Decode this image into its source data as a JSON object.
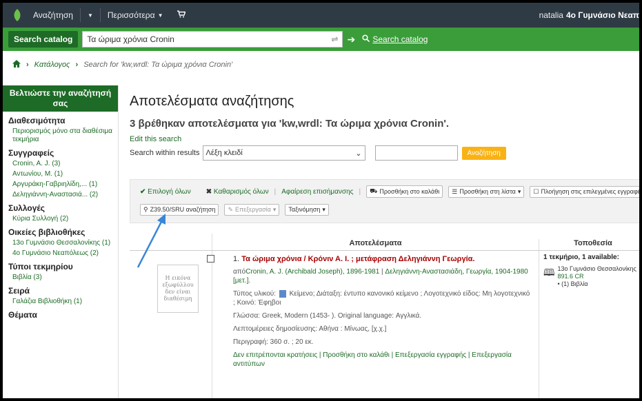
{
  "topnav": {
    "search_label": "Αναζήτηση",
    "more_label": "Περισσότερα",
    "user_name": "natalia",
    "library": "4ο Γυμνάσιο Νεαπ"
  },
  "searchbar": {
    "label": "Search catalog",
    "query": "Τα ώριμα χρόνια Cronin",
    "search_link": "Search catalog"
  },
  "breadcrumb": {
    "catalog": "Κατάλογος",
    "current": "Search for 'kw,wrdl: Τα ώριμα χρόνια Cronin'"
  },
  "sidebar": {
    "refine_title": "Βελτιώστε την αναζήτησή σας",
    "facets": [
      {
        "title": "Διαθεσιμότητα",
        "items": [
          "Περιορισμός μόνο στα διαθέσιμα τεκμήρια"
        ]
      },
      {
        "title": "Συγγραφείς",
        "items": [
          "Cronin, A. J. (3)",
          "Αντωνίου, Μ. (1)",
          "Αργυράκη-Γαβριηλίδη,... (1)",
          "Δεληγιάννη-Αναστασιά... (2)"
        ]
      },
      {
        "title": "Συλλογές",
        "items": [
          "Κύρια Συλλογή (2)"
        ]
      },
      {
        "title": "Οικείες βιβλιοθήκες",
        "items": [
          "13ο Γυμνάσιο Θεσσαλονίκης (1)",
          "4ο Γυμνάσιο Νεαπόλεως (2)"
        ]
      },
      {
        "title": "Τύποι τεκμηρίου",
        "items": [
          "Βιβλία (3)"
        ]
      },
      {
        "title": "Σειρά",
        "items": [
          "Γαλάζια Βιβλιοθήκη (1)"
        ]
      },
      {
        "title": "Θέματα",
        "items": []
      }
    ]
  },
  "main": {
    "title": "Αποτελέσματα αναζήτησης",
    "summary": "3 βρέθηκαν αποτελέσματα για 'kw,wrdl: Τα ώριμα χρόνια Cronin'.",
    "edit_search": "Edit this search",
    "within_label": "Search within results",
    "within_select": "Λέξη κλειδί",
    "within_button": "Αναζήτηση"
  },
  "toolbar": {
    "select_all": "Επιλογή όλων",
    "clear_all": "Καθαρισμός όλων",
    "remove_highlight": "Αφαίρεση επισήμανσης",
    "add_cart": "Προσθήκη στο καλάθι",
    "add_list": "Προσθήκη στη λίστα",
    "place_hold": "Πλοήγηση στις επιλεγμένες εγγραφές",
    "z3950": "Z39.50/SRU αναζήτηση",
    "edit": "Επεξεργασία",
    "sort": "Ταξινόμηση"
  },
  "table": {
    "col_results": "Αποτελέσματα",
    "col_location": "Τοποθεσία",
    "record": {
      "number": "1.",
      "title": "Τα ώριμα χρόνια / Κρόνιν Α. Ι. ; μετάφραση Δεληγιάννη Γεωργία.",
      "cover_text": "Η εικόνα εξωφύλλου δεν είναι διαθέσιμη",
      "author_prefix": "από",
      "author_main": "Cronin, A. J. (Archibald Joseph), 1896-1981",
      "author_sep": " | ",
      "author_second": "Δεληγιάννη-Αναστασιάδη, Γεωργία, 1904-1980 [μετ.].",
      "material_label": "Τύπος υλικού:",
      "material_value": "Κείμενο",
      "arrangement_label": "Διάταξη:",
      "arrangement_value": "έντυπο κανονικό κείμενο",
      "literary_label": "Λογοτεχνικό είδος:",
      "literary_value": "Μη λογοτεχνικό",
      "audience_label": "Κοινό:",
      "audience_value": "Έφηβοι",
      "language_label": "Γλώσσα:",
      "language_value": "Greek, Modern (1453- ).",
      "orig_lang_label": "Original language:",
      "orig_lang_value": "Αγγλικά.",
      "pub_label": "Λεπτομέρειες δημοσίευσης:",
      "pub_value": "Αθήνα : Μίνωας, [χ.χ.]",
      "desc_label": "Περιγραφή:",
      "desc_value": "360 σ. ; 20 εκ.",
      "actions": "Δεν επιτρέπονται κρατήσεις | Προσθήκη στο καλάθι | Επεξεργασία εγγραφής | Επεξεργασία αντιτύπων",
      "availability": "1 τεκμήριο, 1 available:",
      "holding_library": "13ο Γυμνάσιο Θεσσαλονίκης",
      "holding_callnumber": "891.6 CR",
      "holding_type": "• (1) Βιβλία"
    }
  },
  "colors": {
    "nav_bg": "#2f3b44",
    "search_bg": "#3a9d3a",
    "accent": "#1d6b26",
    "button_yellow": "#f9b215",
    "annotation_arrow": "#3a86d8"
  },
  "icons": [
    "leaf-logo-icon",
    "cart-icon",
    "home-icon",
    "search-icon",
    "arrow-right-icon",
    "clear-icon",
    "check-icon",
    "x-icon",
    "book-icon",
    "list-icon",
    "pencil-icon",
    "caret-down-icon"
  ]
}
